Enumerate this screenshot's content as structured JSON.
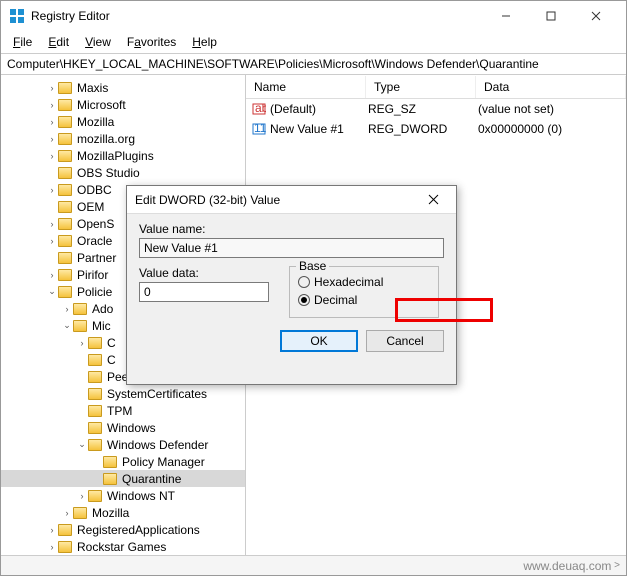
{
  "window": {
    "title": "Registry Editor"
  },
  "menu": {
    "file": "File",
    "edit": "Edit",
    "view": "View",
    "favorites": "Favorites",
    "help": "Help"
  },
  "addressbar": {
    "path": "Computer\\HKEY_LOCAL_MACHINE\\SOFTWARE\\Policies\\Microsoft\\Windows Defender\\Quarantine"
  },
  "tree": {
    "items": [
      {
        "indent": 3,
        "tw": ">",
        "label": "Maxis"
      },
      {
        "indent": 3,
        "tw": ">",
        "label": "Microsoft"
      },
      {
        "indent": 3,
        "tw": ">",
        "label": "Mozilla"
      },
      {
        "indent": 3,
        "tw": ">",
        "label": "mozilla.org"
      },
      {
        "indent": 3,
        "tw": ">",
        "label": "MozillaPlugins"
      },
      {
        "indent": 3,
        "tw": "",
        "label": "OBS Studio"
      },
      {
        "indent": 3,
        "tw": ">",
        "label": "ODBC"
      },
      {
        "indent": 3,
        "tw": "",
        "label": "OEM"
      },
      {
        "indent": 3,
        "tw": ">",
        "label": "OpenS"
      },
      {
        "indent": 3,
        "tw": ">",
        "label": "Oracle"
      },
      {
        "indent": 3,
        "tw": "",
        "label": "Partner"
      },
      {
        "indent": 3,
        "tw": ">",
        "label": "Pirifor"
      },
      {
        "indent": 3,
        "tw": "v",
        "label": "Policie"
      },
      {
        "indent": 4,
        "tw": ">",
        "label": "Ado"
      },
      {
        "indent": 4,
        "tw": "v",
        "label": "Mic"
      },
      {
        "indent": 5,
        "tw": ">",
        "label": "C"
      },
      {
        "indent": 5,
        "tw": "",
        "label": "C"
      },
      {
        "indent": 5,
        "tw": "",
        "label": "Peernet"
      },
      {
        "indent": 5,
        "tw": "",
        "label": "SystemCertificates"
      },
      {
        "indent": 5,
        "tw": "",
        "label": "TPM"
      },
      {
        "indent": 5,
        "tw": "",
        "label": "Windows"
      },
      {
        "indent": 5,
        "tw": "v",
        "label": "Windows Defender"
      },
      {
        "indent": 6,
        "tw": "",
        "label": "Policy Manager"
      },
      {
        "indent": 6,
        "tw": "",
        "label": "Quarantine",
        "selected": true
      },
      {
        "indent": 5,
        "tw": ">",
        "label": "Windows NT"
      },
      {
        "indent": 4,
        "tw": ">",
        "label": "Mozilla"
      },
      {
        "indent": 3,
        "tw": ">",
        "label": "RegisteredApplications"
      },
      {
        "indent": 3,
        "tw": ">",
        "label": "Rockstar Games"
      }
    ]
  },
  "list": {
    "headers": {
      "name": "Name",
      "type": "Type",
      "data": "Data"
    },
    "rows": [
      {
        "icon": "sz",
        "name": "(Default)",
        "type": "REG_SZ",
        "data": "(value not set)"
      },
      {
        "icon": "dw",
        "name": "New Value #1",
        "type": "REG_DWORD",
        "data": "0x00000000 (0)"
      }
    ]
  },
  "dialog": {
    "title": "Edit DWORD (32-bit) Value",
    "value_name_label": "Value name:",
    "value_name": "New Value #1",
    "value_data_label": "Value data:",
    "value_data": "0",
    "base_label": "Base",
    "hex_label": "Hexadecimal",
    "dec_label": "Decimal",
    "ok": "OK",
    "cancel": "Cancel"
  },
  "statusbar": {
    "attribution": "www.deuaq.com"
  }
}
